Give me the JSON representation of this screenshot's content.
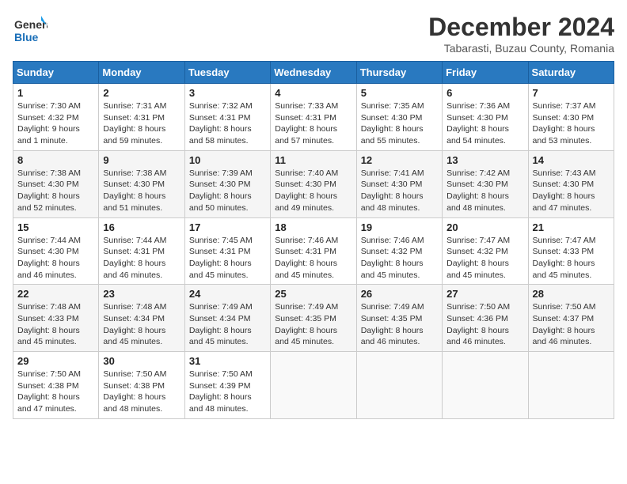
{
  "logo": {
    "line1": "General",
    "line2": "Blue"
  },
  "title": "December 2024",
  "subtitle": "Tabarasti, Buzau County, Romania",
  "weekdays": [
    "Sunday",
    "Monday",
    "Tuesday",
    "Wednesday",
    "Thursday",
    "Friday",
    "Saturday"
  ],
  "weeks": [
    [
      {
        "day": "1",
        "sunrise": "7:30 AM",
        "sunset": "4:32 PM",
        "daylight": "9 hours and 1 minute."
      },
      {
        "day": "2",
        "sunrise": "7:31 AM",
        "sunset": "4:31 PM",
        "daylight": "8 hours and 59 minutes."
      },
      {
        "day": "3",
        "sunrise": "7:32 AM",
        "sunset": "4:31 PM",
        "daylight": "8 hours and 58 minutes."
      },
      {
        "day": "4",
        "sunrise": "7:33 AM",
        "sunset": "4:31 PM",
        "daylight": "8 hours and 57 minutes."
      },
      {
        "day": "5",
        "sunrise": "7:35 AM",
        "sunset": "4:30 PM",
        "daylight": "8 hours and 55 minutes."
      },
      {
        "day": "6",
        "sunrise": "7:36 AM",
        "sunset": "4:30 PM",
        "daylight": "8 hours and 54 minutes."
      },
      {
        "day": "7",
        "sunrise": "7:37 AM",
        "sunset": "4:30 PM",
        "daylight": "8 hours and 53 minutes."
      }
    ],
    [
      {
        "day": "8",
        "sunrise": "7:38 AM",
        "sunset": "4:30 PM",
        "daylight": "8 hours and 52 minutes."
      },
      {
        "day": "9",
        "sunrise": "7:38 AM",
        "sunset": "4:30 PM",
        "daylight": "8 hours and 51 minutes."
      },
      {
        "day": "10",
        "sunrise": "7:39 AM",
        "sunset": "4:30 PM",
        "daylight": "8 hours and 50 minutes."
      },
      {
        "day": "11",
        "sunrise": "7:40 AM",
        "sunset": "4:30 PM",
        "daylight": "8 hours and 49 minutes."
      },
      {
        "day": "12",
        "sunrise": "7:41 AM",
        "sunset": "4:30 PM",
        "daylight": "8 hours and 48 minutes."
      },
      {
        "day": "13",
        "sunrise": "7:42 AM",
        "sunset": "4:30 PM",
        "daylight": "8 hours and 48 minutes."
      },
      {
        "day": "14",
        "sunrise": "7:43 AM",
        "sunset": "4:30 PM",
        "daylight": "8 hours and 47 minutes."
      }
    ],
    [
      {
        "day": "15",
        "sunrise": "7:44 AM",
        "sunset": "4:30 PM",
        "daylight": "8 hours and 46 minutes."
      },
      {
        "day": "16",
        "sunrise": "7:44 AM",
        "sunset": "4:31 PM",
        "daylight": "8 hours and 46 minutes."
      },
      {
        "day": "17",
        "sunrise": "7:45 AM",
        "sunset": "4:31 PM",
        "daylight": "8 hours and 45 minutes."
      },
      {
        "day": "18",
        "sunrise": "7:46 AM",
        "sunset": "4:31 PM",
        "daylight": "8 hours and 45 minutes."
      },
      {
        "day": "19",
        "sunrise": "7:46 AM",
        "sunset": "4:32 PM",
        "daylight": "8 hours and 45 minutes."
      },
      {
        "day": "20",
        "sunrise": "7:47 AM",
        "sunset": "4:32 PM",
        "daylight": "8 hours and 45 minutes."
      },
      {
        "day": "21",
        "sunrise": "7:47 AM",
        "sunset": "4:33 PM",
        "daylight": "8 hours and 45 minutes."
      }
    ],
    [
      {
        "day": "22",
        "sunrise": "7:48 AM",
        "sunset": "4:33 PM",
        "daylight": "8 hours and 45 minutes."
      },
      {
        "day": "23",
        "sunrise": "7:48 AM",
        "sunset": "4:34 PM",
        "daylight": "8 hours and 45 minutes."
      },
      {
        "day": "24",
        "sunrise": "7:49 AM",
        "sunset": "4:34 PM",
        "daylight": "8 hours and 45 minutes."
      },
      {
        "day": "25",
        "sunrise": "7:49 AM",
        "sunset": "4:35 PM",
        "daylight": "8 hours and 45 minutes."
      },
      {
        "day": "26",
        "sunrise": "7:49 AM",
        "sunset": "4:35 PM",
        "daylight": "8 hours and 46 minutes."
      },
      {
        "day": "27",
        "sunrise": "7:50 AM",
        "sunset": "4:36 PM",
        "daylight": "8 hours and 46 minutes."
      },
      {
        "day": "28",
        "sunrise": "7:50 AM",
        "sunset": "4:37 PM",
        "daylight": "8 hours and 46 minutes."
      }
    ],
    [
      {
        "day": "29",
        "sunrise": "7:50 AM",
        "sunset": "4:38 PM",
        "daylight": "8 hours and 47 minutes."
      },
      {
        "day": "30",
        "sunrise": "7:50 AM",
        "sunset": "4:38 PM",
        "daylight": "8 hours and 48 minutes."
      },
      {
        "day": "31",
        "sunrise": "7:50 AM",
        "sunset": "4:39 PM",
        "daylight": "8 hours and 48 minutes."
      },
      null,
      null,
      null,
      null
    ]
  ]
}
